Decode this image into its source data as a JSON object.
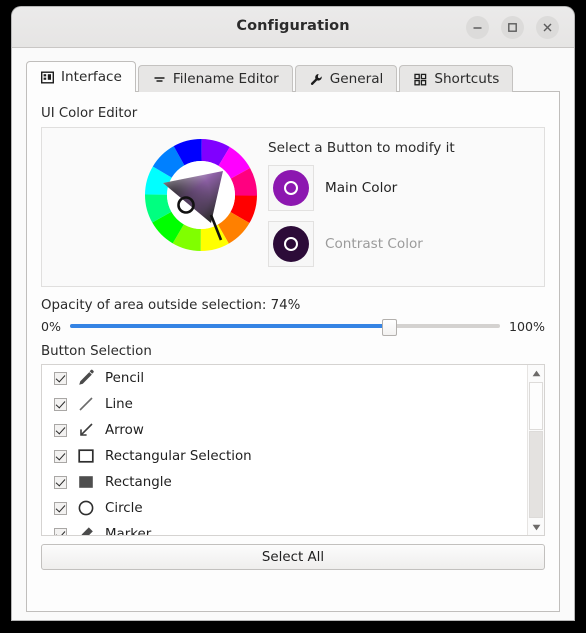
{
  "window": {
    "title": "Configuration",
    "controls": [
      {
        "name": "minimize-button",
        "glyph": "minimize"
      },
      {
        "name": "maximize-button",
        "glyph": "maximize"
      },
      {
        "name": "close-button",
        "glyph": "close"
      }
    ]
  },
  "tabs": [
    {
      "label": "Interface",
      "icon": "interface-icon",
      "active": true
    },
    {
      "label": "Filename Editor",
      "icon": "equals-icon",
      "active": false
    },
    {
      "label": "General",
      "icon": "wrench-icon",
      "active": false
    },
    {
      "label": "Shortcuts",
      "icon": "grid-icon",
      "active": false
    }
  ],
  "color_editor": {
    "group_title": "UI Color Editor",
    "instruction": "Select a Button to modify it",
    "swatches": [
      {
        "label": "Main Color",
        "color": "#8c17b0",
        "enabled": true
      },
      {
        "label": "Contrast Color",
        "color": "#2c0b38",
        "enabled": false
      }
    ]
  },
  "opacity": {
    "label": "Opacity of area outside selection: 74%",
    "value": 74,
    "min_label": "0%",
    "max_label": "100%",
    "fill_color": "#3584e4"
  },
  "button_selection": {
    "label": "Button Selection",
    "items": [
      {
        "label": "Pencil",
        "icon": "pencil-icon",
        "checked": true
      },
      {
        "label": "Line",
        "icon": "line-icon",
        "checked": true
      },
      {
        "label": "Arrow",
        "icon": "arrow-icon",
        "checked": true
      },
      {
        "label": "Rectangular Selection",
        "icon": "rect-outline-icon",
        "checked": true
      },
      {
        "label": "Rectangle",
        "icon": "rect-filled-icon",
        "checked": true
      },
      {
        "label": "Circle",
        "icon": "circle-icon",
        "checked": true
      },
      {
        "label": "Marker",
        "icon": "marker-icon",
        "checked": true
      }
    ],
    "select_all_label": "Select All"
  }
}
